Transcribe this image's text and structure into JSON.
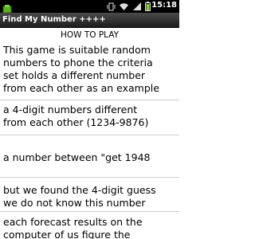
{
  "status_bar": {
    "time": "15:18",
    "icons": [
      "notification-icon",
      "vibrate-icon",
      "wifi-icon",
      "signal-icon",
      "battery-icon"
    ]
  },
  "app": {
    "title": "Find My Number ++++"
  },
  "content": {
    "header": "HOW TO PLAY",
    "items": [
      "This game is suitable random\nnumbers to phone the criteria\nset holds a different number\nfrom each other as an example",
      "a 4-digit numbers different\nfrom each other (1234-9876)",
      "a number between \"get 1948",
      "but we found the 4-digit guess\nwe do not know this number",
      "each forecast results on the\ncomputer of us figure the"
    ]
  }
}
